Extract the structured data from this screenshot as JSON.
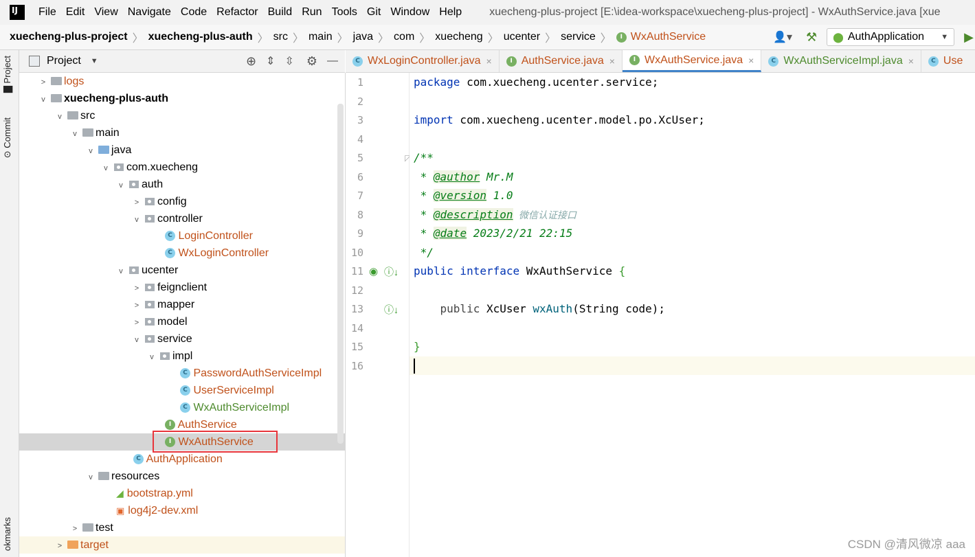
{
  "menu": [
    "File",
    "Edit",
    "View",
    "Navigate",
    "Code",
    "Refactor",
    "Build",
    "Run",
    "Tools",
    "Git",
    "Window",
    "Help"
  ],
  "window_title": "xuecheng-plus-project [E:\\idea-workspace\\xuecheng-plus-project] - WxAuthService.java [xue",
  "breadcrumb": [
    "xuecheng-plus-project",
    "xuecheng-plus-auth",
    "src",
    "main",
    "java",
    "com",
    "xuecheng",
    "ucenter",
    "service",
    "WxAuthService"
  ],
  "run_config": "AuthApplication",
  "sidebar": {
    "project_tab": "Project",
    "commit_tab": "Commit",
    "bookmarks_tab": "okmarks"
  },
  "project_panel": {
    "title": "Project"
  },
  "tree": [
    {
      "label": "logs",
      "arrow": ">"
    },
    {
      "label": "xuecheng-plus-auth",
      "arrow": "v"
    },
    {
      "label": "src",
      "arrow": "v"
    },
    {
      "label": "main",
      "arrow": "v"
    },
    {
      "label": "java",
      "arrow": "v"
    },
    {
      "label": "com.xuecheng",
      "arrow": "v"
    },
    {
      "label": "auth",
      "arrow": "v"
    },
    {
      "label": "config",
      "arrow": ">"
    },
    {
      "label": "controller",
      "arrow": "v"
    },
    {
      "label": "LoginController",
      "arrow": ""
    },
    {
      "label": "WxLoginController",
      "arrow": ""
    },
    {
      "label": "ucenter",
      "arrow": "v"
    },
    {
      "label": "feignclient",
      "arrow": ">"
    },
    {
      "label": "mapper",
      "arrow": ">"
    },
    {
      "label": "model",
      "arrow": ">"
    },
    {
      "label": "service",
      "arrow": "v"
    },
    {
      "label": "impl",
      "arrow": "v"
    },
    {
      "label": "PasswordAuthServiceImpl",
      "arrow": ""
    },
    {
      "label": "UserServiceImpl",
      "arrow": ""
    },
    {
      "label": "WxAuthServiceImpl",
      "arrow": ""
    },
    {
      "label": "AuthService",
      "arrow": ""
    },
    {
      "label": "WxAuthService",
      "arrow": ""
    },
    {
      "label": "AuthApplication",
      "arrow": ""
    },
    {
      "label": "resources",
      "arrow": "v"
    },
    {
      "label": "bootstrap.yml",
      "arrow": ""
    },
    {
      "label": "log4j2-dev.xml",
      "arrow": ""
    },
    {
      "label": "test",
      "arrow": ">"
    },
    {
      "label": "target",
      "arrow": ">"
    }
  ],
  "tabs": [
    {
      "label": "WxLoginController.java",
      "close": "×"
    },
    {
      "label": "AuthService.java",
      "close": "×"
    },
    {
      "label": "WxAuthService.java",
      "close": "×"
    },
    {
      "label": "WxAuthServiceImpl.java",
      "close": "×"
    },
    {
      "label": "Use",
      "close": ""
    }
  ],
  "line_numbers": [
    "1",
    "2",
    "3",
    "4",
    "5",
    "6",
    "7",
    "8",
    "9",
    "10",
    "11",
    "12",
    "13",
    "14",
    "15",
    "16"
  ],
  "code": {
    "l1_kw": "package",
    "l1_rest": " com.xuecheng.ucenter.service;",
    "l3_kw": "import",
    "l3_rest": " com.xuecheng.ucenter.model.po.XcUser;",
    "l5": "/**",
    "l6_star": " * ",
    "l6_tag": "@author",
    "l6_val": " Mr.M",
    "l7_star": " * ",
    "l7_tag": "@version",
    "l7_val": " 1.0",
    "l8_star": " * ",
    "l8_tag": "@description",
    "l8_val": " 微信认证接口",
    "l9_star": " * ",
    "l9_tag": "@date",
    "l9_val": " 2023/2/21 22:15",
    "l10": " */",
    "l11_kw1": "public",
    "l11_kw2": " interface",
    "l11_name": " WxAuthService ",
    "l11_brace": "{",
    "l13_kw": "    public",
    "l13_type": " XcUser ",
    "l13_fn": "wxAuth",
    "l13_rest": "(String code);",
    "l15": "}"
  },
  "watermark": "CSDN @清风微凉 aaa"
}
